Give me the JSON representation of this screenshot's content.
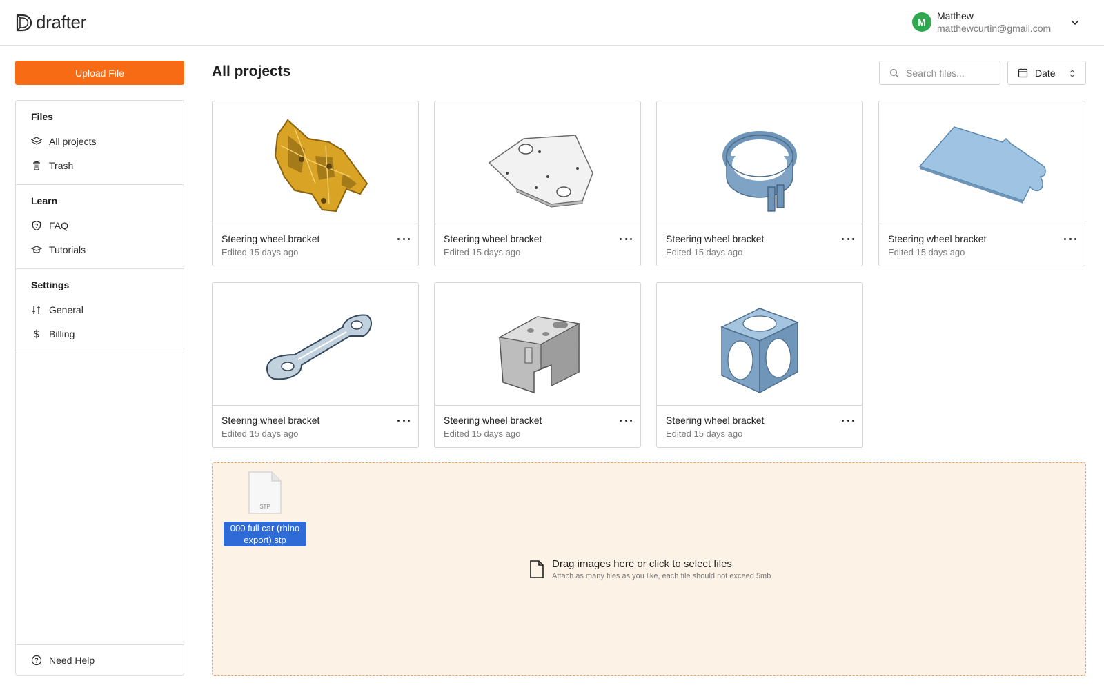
{
  "header": {
    "logo_text": "drafter",
    "user": {
      "initial": "M",
      "name": "Matthew",
      "email": "matthewcurtin@gmail.com",
      "avatar_color": "#2fa84f"
    }
  },
  "sidebar": {
    "upload_label": "Upload File",
    "sections": [
      {
        "title": "Files",
        "items": [
          {
            "label": "All projects",
            "icon": "layers-icon"
          },
          {
            "label": "Trash",
            "icon": "trash-icon"
          }
        ]
      },
      {
        "title": "Learn",
        "items": [
          {
            "label": "FAQ",
            "icon": "shield-question-icon"
          },
          {
            "label": "Tutorials",
            "icon": "graduation-cap-icon"
          }
        ]
      },
      {
        "title": "Settings",
        "items": [
          {
            "label": "General",
            "icon": "sliders-icon"
          },
          {
            "label": "Billing",
            "icon": "dollar-icon"
          }
        ]
      }
    ],
    "help_label": "Need Help"
  },
  "main": {
    "title": "All projects",
    "search_placeholder": "Search files...",
    "sort_label": "Date",
    "projects": [
      {
        "name": "Steering wheel bracket",
        "edited": "Edited 15 days ago",
        "model": "gold-bracket"
      },
      {
        "name": "Steering wheel bracket",
        "edited": "Edited 15 days ago",
        "model": "white-plate"
      },
      {
        "name": "Steering wheel bracket",
        "edited": "Edited 15 days ago",
        "model": "blue-clamp-ring"
      },
      {
        "name": "Steering wheel bracket",
        "edited": "Edited 15 days ago",
        "model": "blue-flat-plate"
      },
      {
        "name": "Steering wheel bracket",
        "edited": "Edited 15 days ago",
        "model": "glass-link-arm"
      },
      {
        "name": "Steering wheel bracket",
        "edited": "Edited 15 days ago",
        "model": "gray-block"
      },
      {
        "name": "Steering wheel bracket",
        "edited": "Edited 15 days ago",
        "model": "blue-cube"
      }
    ]
  },
  "dropzone": {
    "dragged_file_ext": "STP",
    "dragged_file_name": "000 full car (rhino export).stp",
    "main_text": "Drag images here or click to select files",
    "sub_text": "Attach as many files as you like, each file should not exceed 5mb",
    "accent": "#f76b15"
  }
}
